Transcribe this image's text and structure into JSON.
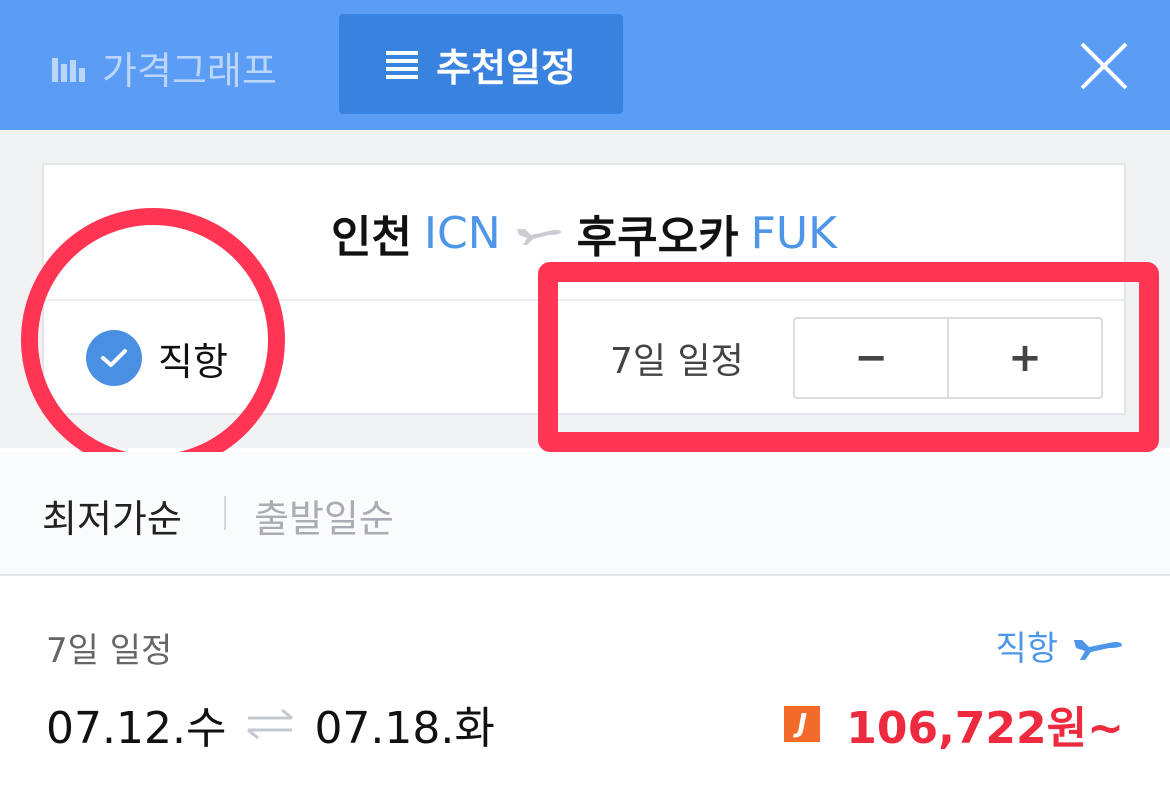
{
  "header": {
    "tabs": [
      {
        "label": "가격그래프",
        "icon": "bar-chart-icon",
        "active": false
      },
      {
        "label": "추천일정",
        "icon": "list-icon",
        "active": true
      }
    ],
    "close_icon": "close-icon"
  },
  "route": {
    "origin_city": "인천",
    "origin_code": "ICN",
    "destination_city": "후쿠오카",
    "destination_code": "FUK"
  },
  "filters": {
    "direct_label": "직항",
    "direct_checked": true,
    "duration_label": "7일 일정",
    "minus_label": "−",
    "plus_label": "+"
  },
  "sort": {
    "active": "최저가순",
    "inactive": "출발일순"
  },
  "results": [
    {
      "duration": "7일 일정",
      "flight_type": "직항",
      "depart": "07.12.수",
      "return": "07.18.화",
      "airline_logo": "J",
      "price": "106,722원~"
    }
  ],
  "colors": {
    "header": "#5b9cf5",
    "active_tab": "#3a82df",
    "accent_blue": "#4e96e8",
    "price_red": "#ee2a3e",
    "annotation": "#ff3553"
  }
}
